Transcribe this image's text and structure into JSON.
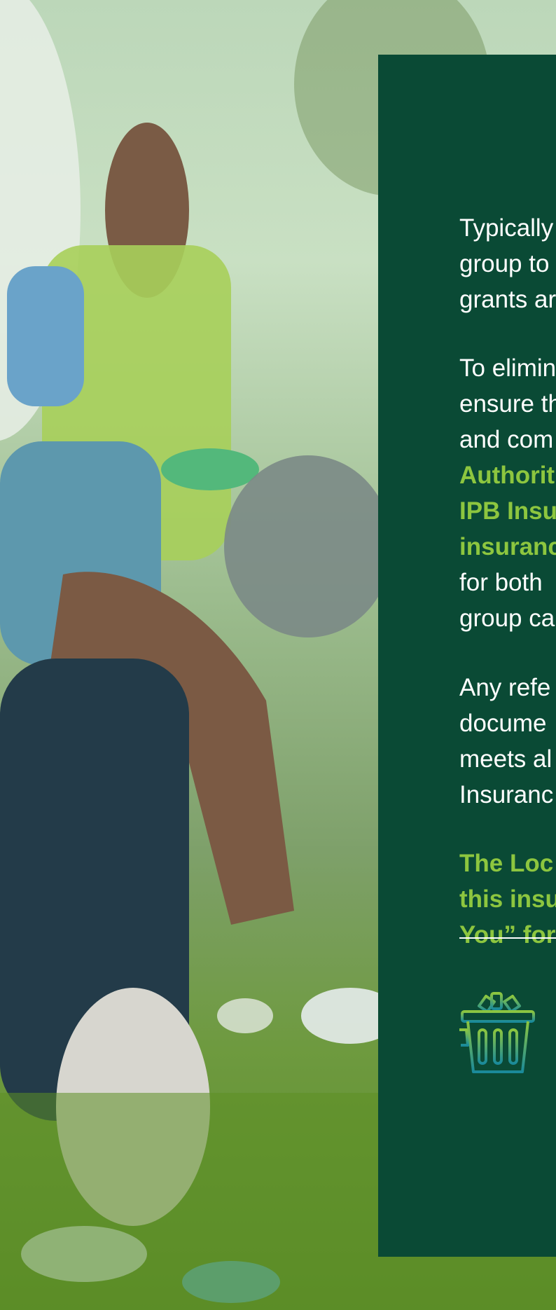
{
  "panel": {
    "para1": [
      "Typically",
      "group to",
      "grants ar"
    ],
    "para2_white": [
      "To elimin",
      "ensure th",
      "and com"
    ],
    "para2_green": [
      "Authorit",
      "IPB Insu",
      "insuranc"
    ],
    "para2_tail": [
      "for both",
      "group ca"
    ],
    "para3": [
      "Any refe",
      "docume",
      "meets al",
      "Insuranc"
    ],
    "para4": [
      "The Loc",
      "this insu",
      "You” for"
    ]
  },
  "icons": {
    "bin": "recycling-bin-icon"
  },
  "colors": {
    "panel": "#0a4a35",
    "accent": "#8dc63f",
    "icon": "#1a8a8a"
  }
}
